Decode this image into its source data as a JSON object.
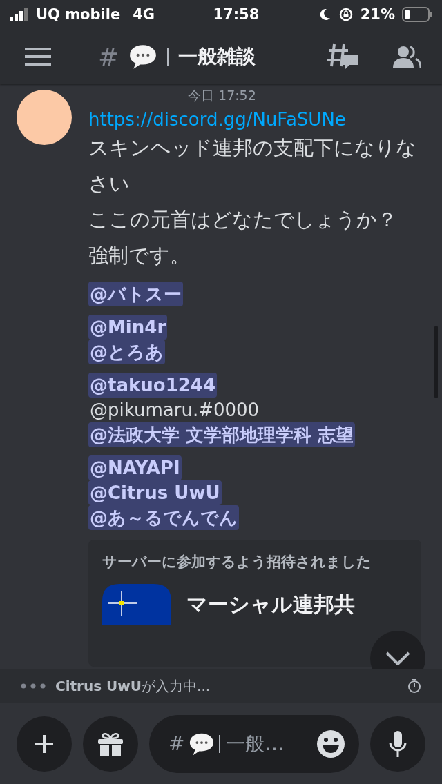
{
  "status_bar": {
    "carrier": "UQ mobile",
    "network": "4G",
    "time": "17:58",
    "battery": "21%"
  },
  "header": {
    "prefix": "#",
    "channel": "一般雑談"
  },
  "message": {
    "timestamp": "今日 17:52",
    "link": "https://discord.gg/NuFaSUNe",
    "paragraphs": [
      "スキンヘッド連邦の支配下になりなさい",
      "ここの元首はどなたでしょうか？",
      "強制です。"
    ],
    "mention_groups": [
      [
        {
          "kind": "mention",
          "text": "@バトスー"
        }
      ],
      [
        {
          "kind": "mention",
          "text": "@Min4r"
        },
        {
          "kind": "mention",
          "text": "@とろあ"
        }
      ],
      [
        {
          "kind": "mention",
          "text": "@takuo1244"
        },
        {
          "kind": "text",
          "text": "@pikumaru.#0000"
        },
        {
          "kind": "mention",
          "text": "@法政大学 文学部地理学科 志望"
        }
      ],
      [
        {
          "kind": "mention",
          "text": "@NAYAPI"
        },
        {
          "kind": "mention",
          "text": "@Citrus UwU"
        },
        {
          "kind": "mention",
          "text": "@あ～るでんでん"
        }
      ]
    ],
    "invite": {
      "heading": "サーバーに参加するよう招待されました",
      "server_name": "マーシャル連邦共"
    }
  },
  "typing": {
    "text": "**Citrus UwU**が入力中..."
  },
  "composer": {
    "prefix": "#",
    "placeholder": "一般…"
  }
}
